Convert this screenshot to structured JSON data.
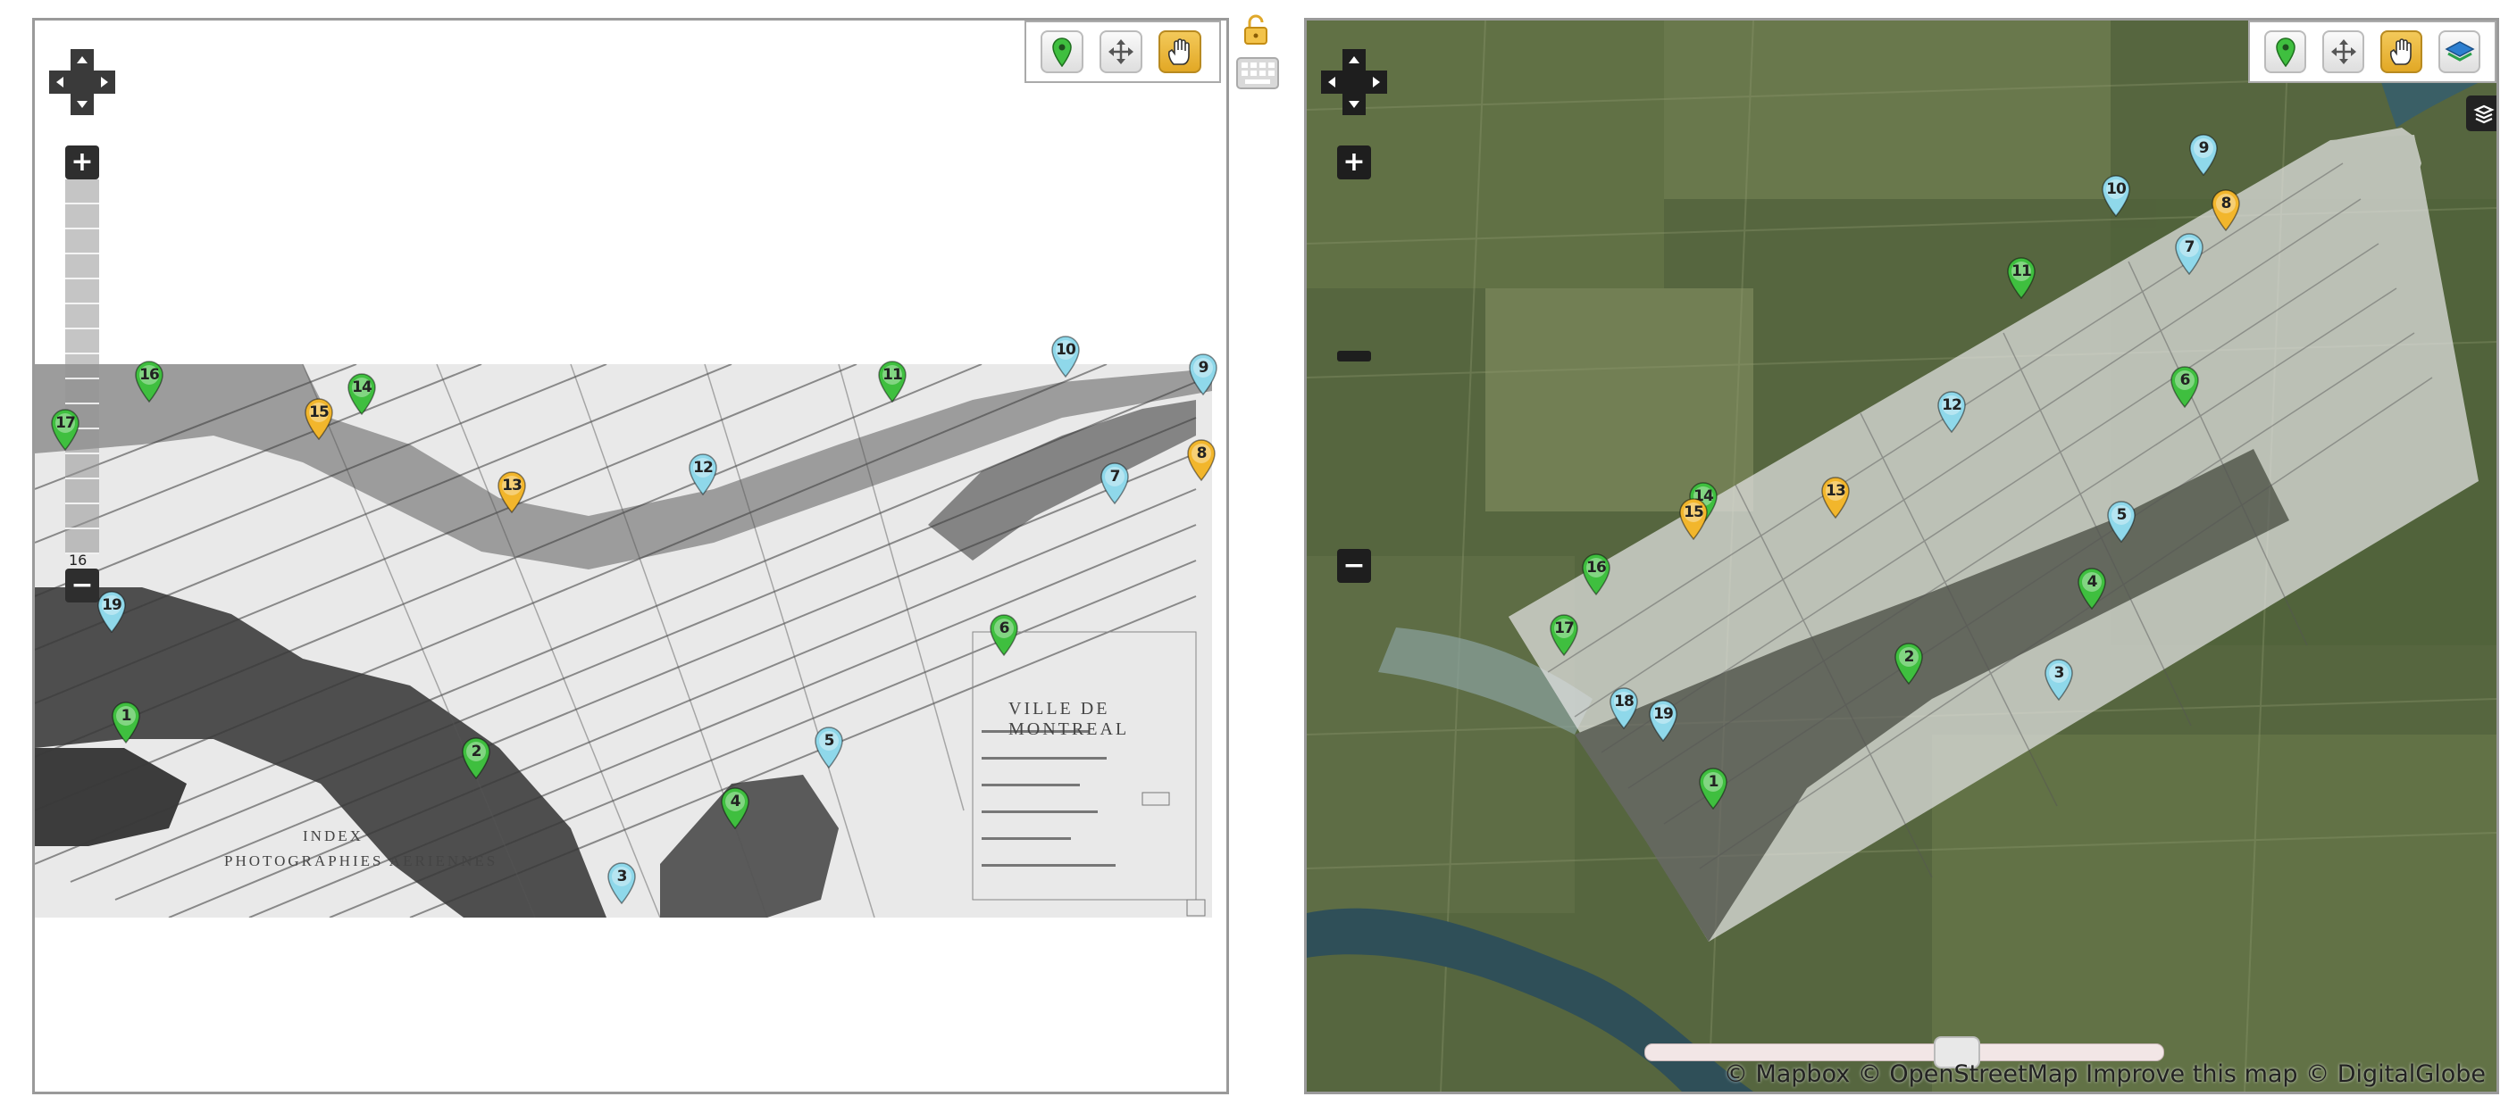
{
  "left_map": {
    "title_lines": [
      "VILLE DE MONTREAL"
    ],
    "index_lines": [
      "INDEX",
      "PHOTOGRAPHIES AERIENNES"
    ],
    "zoom_level_label": "16",
    "markers": [
      {
        "num": "1",
        "color": "green"
      },
      {
        "num": "2",
        "color": "green"
      },
      {
        "num": "3",
        "color": "blue"
      },
      {
        "num": "4",
        "color": "green"
      },
      {
        "num": "5",
        "color": "blue"
      },
      {
        "num": "6",
        "color": "green"
      },
      {
        "num": "7",
        "color": "blue"
      },
      {
        "num": "8",
        "color": "yellow"
      },
      {
        "num": "9",
        "color": "blue"
      },
      {
        "num": "10",
        "color": "blue"
      },
      {
        "num": "11",
        "color": "green"
      },
      {
        "num": "12",
        "color": "blue"
      },
      {
        "num": "13",
        "color": "yellow"
      },
      {
        "num": "14",
        "color": "green"
      },
      {
        "num": "15",
        "color": "yellow"
      },
      {
        "num": "16",
        "color": "green"
      },
      {
        "num": "17",
        "color": "green"
      },
      {
        "num": "19",
        "color": "blue"
      }
    ]
  },
  "right_map": {
    "markers": [
      {
        "num": "1",
        "color": "green"
      },
      {
        "num": "2",
        "color": "green"
      },
      {
        "num": "3",
        "color": "blue"
      },
      {
        "num": "4",
        "color": "green"
      },
      {
        "num": "5",
        "color": "blue"
      },
      {
        "num": "6",
        "color": "green"
      },
      {
        "num": "7",
        "color": "blue"
      },
      {
        "num": "8",
        "color": "yellow"
      },
      {
        "num": "9",
        "color": "blue"
      },
      {
        "num": "10",
        "color": "blue"
      },
      {
        "num": "11",
        "color": "green"
      },
      {
        "num": "12",
        "color": "blue"
      },
      {
        "num": "13",
        "color": "yellow"
      },
      {
        "num": "14",
        "color": "green"
      },
      {
        "num": "15",
        "color": "yellow"
      },
      {
        "num": "16",
        "color": "green"
      },
      {
        "num": "17",
        "color": "green"
      },
      {
        "num": "18",
        "color": "blue"
      },
      {
        "num": "19",
        "color": "blue"
      }
    ],
    "attribution": "© Mapbox © OpenStreetMap Improve this map © DigitalGlobe",
    "opacity_fraction": 0.6
  },
  "toolbar": {
    "left_tools": [
      "add-marker",
      "move",
      "pan"
    ],
    "right_tools": [
      "add-marker",
      "move",
      "pan",
      "layers"
    ],
    "active_tool": "pan"
  },
  "colors": {
    "green": "#3fbf3f",
    "blue": "#8fd8ea",
    "yellow": "#f2b62c",
    "active": "#e9b12e"
  }
}
